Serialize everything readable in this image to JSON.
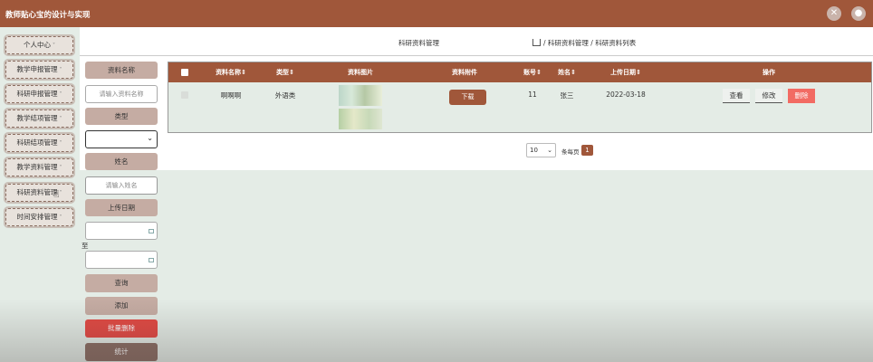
{
  "app": {
    "title": "教师贴心宝的设计与实现"
  },
  "sidebar": {
    "items": [
      {
        "label": "个人中心"
      },
      {
        "label": "教学申报管理"
      },
      {
        "label": "科研申报管理"
      },
      {
        "label": "教学结项管理"
      },
      {
        "label": "科研结项管理"
      },
      {
        "label": "教学资料管理"
      },
      {
        "label": "科研资料管理"
      },
      {
        "label": "时间安排管理"
      }
    ]
  },
  "breadcrumb": {
    "label": "科研资料管理",
    "path": "/ 科研资料管理 / 科研资料列表"
  },
  "search": {
    "name_label": "资料名称",
    "name_placeholder": "请输入资料名称",
    "type_label": "类型",
    "person_label": "姓名",
    "person_placeholder": "请输入姓名",
    "date_label": "上传日期",
    "to_label": "至",
    "query_button": "查询",
    "add_button": "添加",
    "batch_delete_button": "批量删除",
    "stats_button": "统计"
  },
  "table": {
    "headers": [
      "资料名称",
      "类型",
      "资料图片",
      "资料附件",
      "账号",
      "姓名",
      "上传日期",
      "操作"
    ],
    "rows": [
      {
        "name": "啊啊啊",
        "type": "外语类",
        "attachment_button": "下载",
        "account": "11",
        "person": "张三",
        "date": "2022-03-18",
        "view_button": "查看",
        "edit_button": "修改",
        "delete_button": "删除"
      }
    ]
  },
  "pagination": {
    "page_size": "10",
    "page_size_label": "条每页",
    "current_page": "1"
  },
  "colors": {
    "primary": "#a0573a",
    "danger": "#e34a44",
    "background": "#e4ece6"
  },
  "icons": [
    "close-icon",
    "user-icon",
    "home-icon",
    "calendar-icon",
    "chevron-down-icon",
    "sort-icon"
  ]
}
